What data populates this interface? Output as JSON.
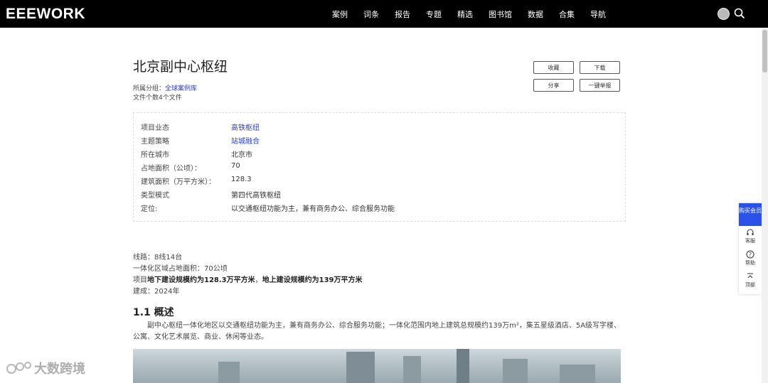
{
  "header": {
    "logo": "EEEWORK",
    "nav": [
      "案例",
      "词条",
      "报告",
      "专题",
      "精选",
      "图书馆",
      "数据",
      "合集",
      "导航"
    ]
  },
  "title": "北京副中心枢纽",
  "meta": {
    "category_label": "所属分组：",
    "category_link": "全球案例库",
    "file_count": "文件个数4个文件"
  },
  "actions": {
    "collect": "收藏",
    "download": "下载",
    "share": "分享",
    "report": "一键举报"
  },
  "info": [
    {
      "key": "项目业态",
      "value": "高铁枢纽",
      "link": true
    },
    {
      "key": "主题策略",
      "value": "站城融合",
      "link": true
    },
    {
      "key": "所在城市",
      "value": "北京市",
      "link": false
    },
    {
      "key": "占地面积（公顷）：",
      "value": "70",
      "link": false
    },
    {
      "key": "建筑面积（万平方米）：",
      "value": "128.3",
      "link": false
    },
    {
      "key": "类型模式",
      "value": "第四代高铁枢纽",
      "link": false
    },
    {
      "key": "定位:",
      "value": "以交通枢纽功能为主，兼有商务办公、综合服务功能",
      "link": false
    }
  ],
  "body": {
    "line1": "线路：8线14台",
    "line2": "一体化区域占地面积：70公顷",
    "line3_prefix": "项目",
    "line3_bold1": "地下建设规模约为128.3万平方米",
    "line3_sep": "，",
    "line3_bold2": "地上建设规模约为139万平方米",
    "line4": "建成：2024年"
  },
  "section": {
    "title": "1.1  概述",
    "paragraph": "副中心枢纽一体化地区以交通枢纽功能为主，兼有商务办公、综合服务功能；一体化范围内地上建筑总规模约139万m²，集五星级酒店、5A级写字楼、公寓、文化艺术展览、商业、休闲等业态。"
  },
  "float_panel": {
    "buy_vip": "购买会员",
    "service": "客服",
    "help": "帮助",
    "top": "顶部"
  },
  "watermark": "大数跨境"
}
